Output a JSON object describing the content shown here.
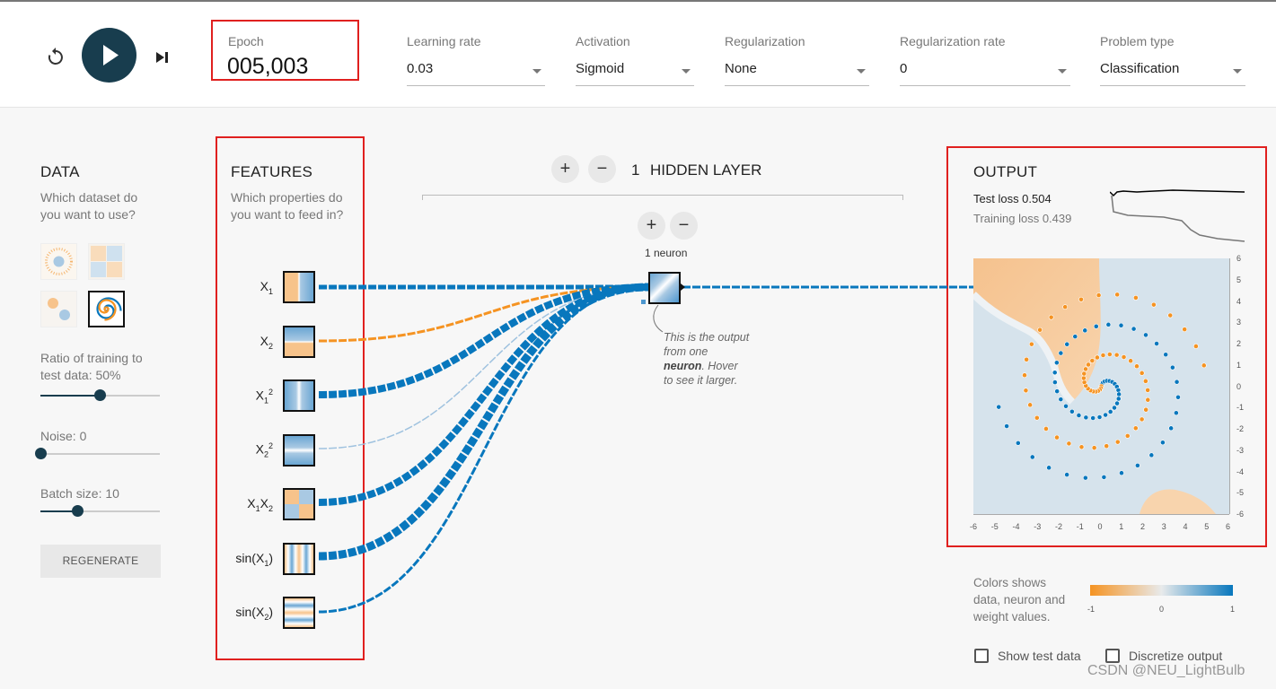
{
  "controls": {
    "reset_icon": "reset-icon",
    "play_icon": "play-icon",
    "step_icon": "step-icon",
    "epoch_label": "Epoch",
    "epoch_value": "005,003",
    "learning_rate": {
      "label": "Learning rate",
      "value": "0.03"
    },
    "activation": {
      "label": "Activation",
      "value": "Sigmoid"
    },
    "regularization": {
      "label": "Regularization",
      "value": "None"
    },
    "regularization_rate": {
      "label": "Regularization rate",
      "value": "0"
    },
    "problem_type": {
      "label": "Problem type",
      "value": "Classification"
    }
  },
  "data_panel": {
    "title": "DATA",
    "subtitle_line1": "Which dataset do",
    "subtitle_line2": "you want to use?",
    "ratio_label_line1": "Ratio of training to",
    "ratio_label_line2": "test data:  50%",
    "ratio_value": 0.5,
    "noise_label": "Noise:  0",
    "noise_value": 0,
    "batch_label": "Batch size:  10",
    "batch_fraction": 0.33,
    "regenerate_label": "REGENERATE",
    "selected_dataset": "spiral"
  },
  "features_panel": {
    "title": "FEATURES",
    "subtitle_line1": "Which properties do",
    "subtitle_line2": "you want to feed in?",
    "features": [
      {
        "base": "X",
        "sub": "1",
        "sup": ""
      },
      {
        "base": "X",
        "sub": "2",
        "sup": ""
      },
      {
        "base": "X",
        "sub": "1",
        "sup": "2"
      },
      {
        "base": "X",
        "sub": "2",
        "sup": "2"
      },
      {
        "base": "X",
        "sub": "1",
        "sup": "",
        "base2": "X",
        "sub2": "2"
      },
      {
        "base": "sin(X",
        "sub": "1",
        "sup": "",
        "tail": ")"
      },
      {
        "base": "sin(X",
        "sub": "2",
        "sup": "",
        "tail": ")"
      }
    ]
  },
  "network": {
    "hidden_layers_count": "1",
    "hidden_layer_label": "HIDDEN LAYER",
    "neuron_label": "1 neuron",
    "add_icon": "+",
    "remove_icon": "−",
    "tooltip_line1": "This is the output",
    "tooltip_line2": "from one",
    "tooltip_bold": "neuron",
    "tooltip_line3_rest": ". Hover",
    "tooltip_line4": "to see it larger."
  },
  "output_panel": {
    "title": "OUTPUT",
    "test_loss_label": "Test loss 0.504",
    "training_loss_label": "Training loss 0.439",
    "x_ticks": [
      "-6",
      "-5",
      "-4",
      "-3",
      "-2",
      "-1",
      "0",
      "1",
      "2",
      "3",
      "4",
      "5",
      "6"
    ],
    "y_ticks": [
      "6",
      "5",
      "4",
      "3",
      "2",
      "1",
      "0",
      "-1",
      "-2",
      "-3",
      "-4",
      "-5",
      "-6"
    ],
    "legend_text_line1": "Colors shows",
    "legend_text_line2": "data, neuron and",
    "legend_text_line3": "weight values.",
    "legend_min": "-1",
    "legend_mid": "0",
    "legend_max": "1",
    "show_test_data_label": "Show test data",
    "discretize_label": "Discretize output"
  },
  "colors": {
    "orange": "#f59322",
    "blue": "#0877bd",
    "dark": "#183d4e",
    "highlight_box": "#e0201f"
  },
  "watermark": "CSDN @NEU_LightBulb"
}
